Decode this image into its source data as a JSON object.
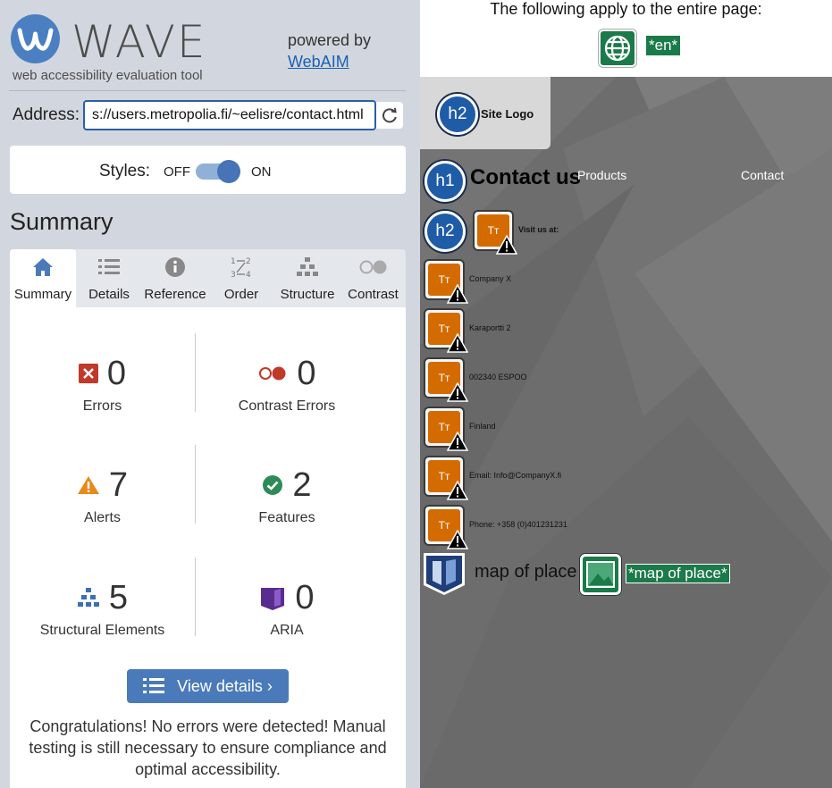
{
  "header": {
    "app_name": "WAVE",
    "tagline": "web accessibility evaluation tool",
    "powered_by": "powered by",
    "webaim_link": "WebAIM"
  },
  "address": {
    "label": "Address:",
    "value": "s://users.metropolia.fi/~eelisre/contact.html",
    "reload_icon": "reload-icon"
  },
  "styles": {
    "label": "Styles:",
    "off": "OFF",
    "on": "ON",
    "state": "on"
  },
  "summary_heading": "Summary",
  "tabs": [
    {
      "label": "Summary",
      "icon": "home-icon",
      "active": true
    },
    {
      "label": "Details",
      "icon": "list-icon",
      "active": false
    },
    {
      "label": "Reference",
      "icon": "info-icon",
      "active": false
    },
    {
      "label": "Order",
      "icon": "order-icon",
      "active": false
    },
    {
      "label": "Structure",
      "icon": "structure-icon",
      "active": false
    },
    {
      "label": "Contrast",
      "icon": "contrast-icon",
      "active": false
    }
  ],
  "stats": {
    "errors": {
      "count": "0",
      "label": "Errors"
    },
    "contrast_errors": {
      "count": "0",
      "label": "Contrast Errors"
    },
    "alerts": {
      "count": "7",
      "label": "Alerts"
    },
    "features": {
      "count": "2",
      "label": "Features"
    },
    "structural": {
      "count": "5",
      "label": "Structural Elements"
    },
    "aria": {
      "count": "0",
      "label": "ARIA"
    }
  },
  "view_details": "View details ›",
  "congrats": "Congratulations! No errors were detected! Manual testing is still necessary to ensure compliance and optimal accessibility.",
  "colors": {
    "accent_blue": "#4a7ab9",
    "error_red": "#c0392b",
    "alert_orange": "#e8891b",
    "feature_green": "#2e8b57",
    "aria_purple": "#5b2c8f"
  },
  "preview": {
    "whole_page_note": "The following apply to the entire page:",
    "lang_code": "*en*",
    "site_logo": "Site Logo",
    "h2": "h2",
    "h1": "h1",
    "contact_heading": "Contact us",
    "nav_products": "Products",
    "nav_contact": "Contact",
    "text_small": "Tт",
    "items": [
      "Visit us at:",
      "Company X",
      "Karaportti 2",
      "002340 ESPOO",
      "Finland",
      "Email: Info@CompanyX.fi",
      "Phone: +358 (0)401231231"
    ],
    "map_label": "map of place",
    "map_alt": "*map of place*"
  }
}
